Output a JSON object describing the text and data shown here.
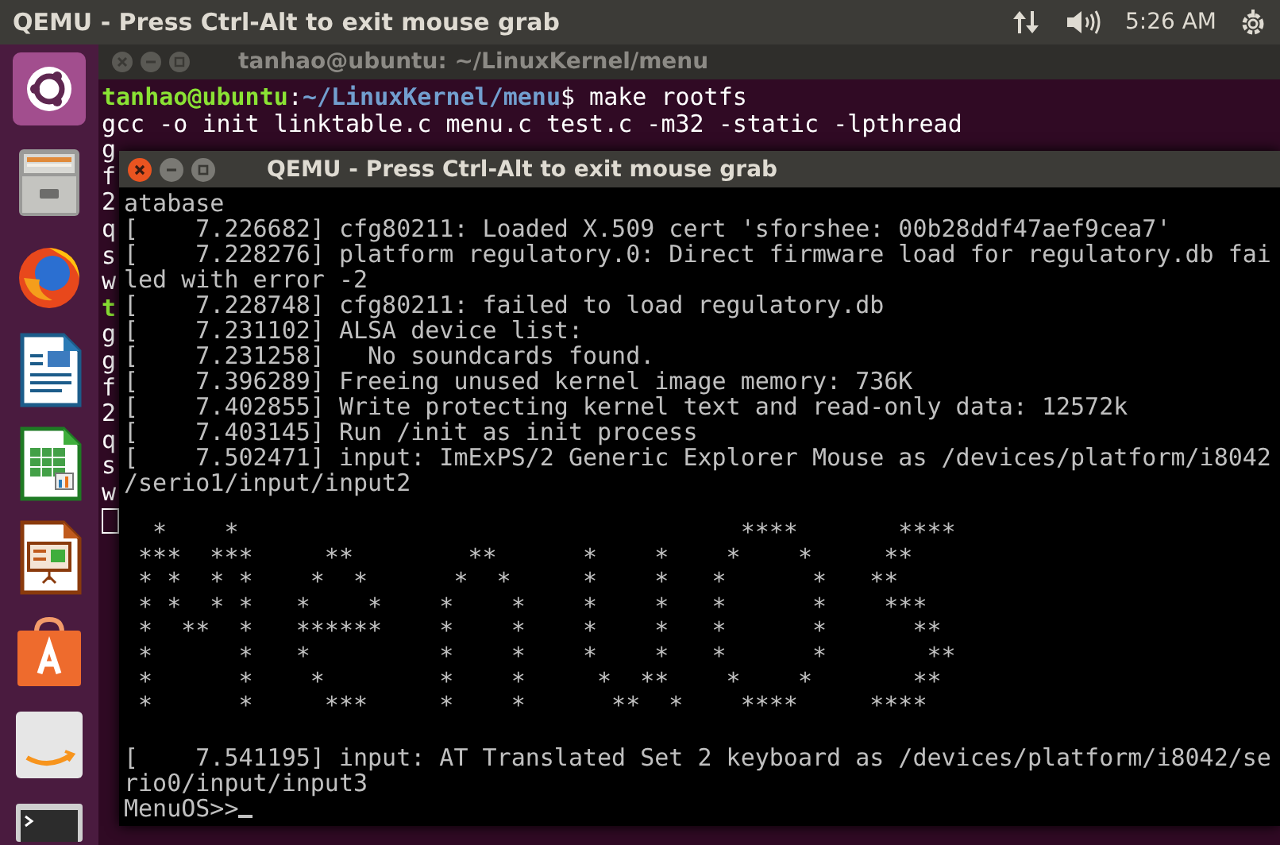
{
  "top_bar": {
    "title": "QEMU - Press Ctrl-Alt to exit mouse grab",
    "clock": "5:26 AM"
  },
  "launcher": {
    "items": [
      {
        "kind": "ubuntu"
      },
      {
        "kind": "files"
      },
      {
        "kind": "browser"
      },
      {
        "kind": "writer"
      },
      {
        "kind": "calc"
      },
      {
        "kind": "impress"
      },
      {
        "kind": "store"
      },
      {
        "kind": "shop"
      },
      {
        "kind": "terminal"
      }
    ]
  },
  "terminal": {
    "title": "tanhao@ubuntu: ~/LinuxKernel/menu",
    "prompt": {
      "user": "tanhao@ubuntu",
      "separator": ":",
      "path": "~/LinuxKernel/menu",
      "command": "$ make rootfs"
    },
    "lines": [
      "gcc -o init linktable.c menu.c test.c -m32 -static -lpthread"
    ],
    "hidden_lines": [
      {
        "text": "g",
        "kind": "output"
      },
      {
        "text": "f",
        "kind": "output"
      },
      {
        "text": "2",
        "kind": "output"
      },
      {
        "text": "q",
        "kind": "output"
      },
      {
        "text": "s",
        "kind": "output"
      },
      {
        "text": "w",
        "kind": "output"
      },
      {
        "text": "t",
        "kind": "prompt"
      },
      {
        "text": "g",
        "kind": "output"
      },
      {
        "text": "g",
        "kind": "output"
      },
      {
        "text": "f",
        "kind": "output"
      },
      {
        "text": "2",
        "kind": "output"
      },
      {
        "text": "q",
        "kind": "output"
      },
      {
        "text": "s",
        "kind": "output"
      },
      {
        "text": "w",
        "kind": "output"
      }
    ]
  },
  "qemu": {
    "title": "QEMU - Press Ctrl-Alt to exit mouse grab",
    "log_before": [
      "atabase",
      "[    7.226682] cfg80211: Loaded X.509 cert 'sforshee: 00b28ddf47aef9cea7'",
      "[    7.228276] platform regulatory.0: Direct firmware load for regulatory.db fai",
      "led with error -2",
      "[    7.228748] cfg80211: failed to load regulatory.db",
      "[    7.231102] ALSA device list:",
      "[    7.231258]   No soundcards found.",
      "[    7.396289] Freeing unused kernel image memory: 736K",
      "[    7.402855] Write protecting kernel text and read-only data: 12572k",
      "[    7.403145] Run /init as init process",
      "[    7.502471] input: ImExPS/2 Generic Explorer Mouse as /devices/platform/i8042",
      "/serio1/input/input2"
    ],
    "banner": "  *    *                                   ****       ****\n ***  ***     **        **      *    *    *    *     **\n * *  * *    *  *      *  *     *    *   *      *   **\n * *  * *   *    *    *    *    *    *   *      *    ***\n *  **  *   ******    *    *    *    *   *      *      **\n *      *   *         *    *    *    *   *      *       **\n *      *    *        *    *     *  **    *    *       **\n *      *     ***     *    *      **  *    ****     ****",
    "log_after": [
      "[    7.541195] input: AT Translated Set 2 keyboard as /devices/platform/i8042/se",
      "rio0/input/input3"
    ],
    "prompt": "MenuOS>>"
  }
}
